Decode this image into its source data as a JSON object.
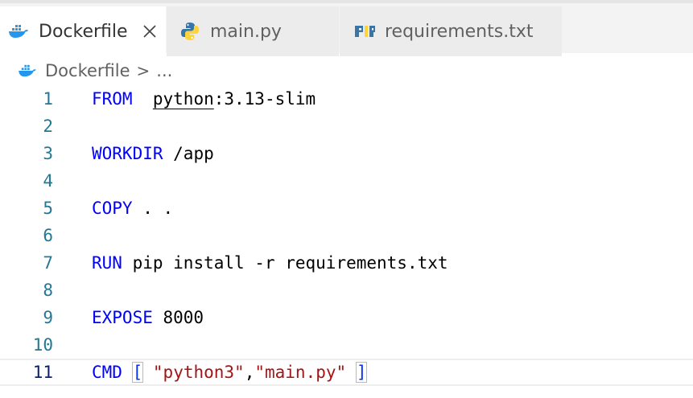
{
  "tabs": [
    {
      "label": "Dockerfile",
      "active": true,
      "icon": "docker-icon",
      "close": "✕"
    },
    {
      "label": "main.py",
      "active": false,
      "icon": "python-icon"
    },
    {
      "label": "requirements.txt",
      "active": false,
      "icon": "pip-icon"
    }
  ],
  "breadcrumb": {
    "file": "Dockerfile",
    "separator": ">",
    "more": "..."
  },
  "editor": {
    "current_line": 11,
    "lines": [
      {
        "num": "1",
        "keyword": "FROM",
        "rest_pre": "  ",
        "image": "python",
        "rest": ":3.13-slim"
      },
      {
        "num": "2"
      },
      {
        "num": "3",
        "keyword": "WORKDIR",
        "rest": " /app"
      },
      {
        "num": "4"
      },
      {
        "num": "5",
        "keyword": "COPY",
        "rest": " . ."
      },
      {
        "num": "6"
      },
      {
        "num": "7",
        "keyword": "RUN",
        "rest": " pip install -r requirements.txt"
      },
      {
        "num": "8"
      },
      {
        "num": "9",
        "keyword": "EXPOSE",
        "rest": " 8000"
      },
      {
        "num": "10"
      },
      {
        "num": "11",
        "keyword": "CMD",
        "open_bracket": "[",
        "str1": "\"python3\"",
        "comma": ",",
        "str2": "\"main.py\"",
        "close_bracket": "]"
      }
    ]
  },
  "colors": {
    "keyword": "#0000ff",
    "string": "#a31515",
    "line_number": "#237893",
    "line_number_active": "#0b216f",
    "docker_blue": "#2496ed",
    "python_blue": "#3776ab",
    "python_yellow": "#ffd43b"
  }
}
